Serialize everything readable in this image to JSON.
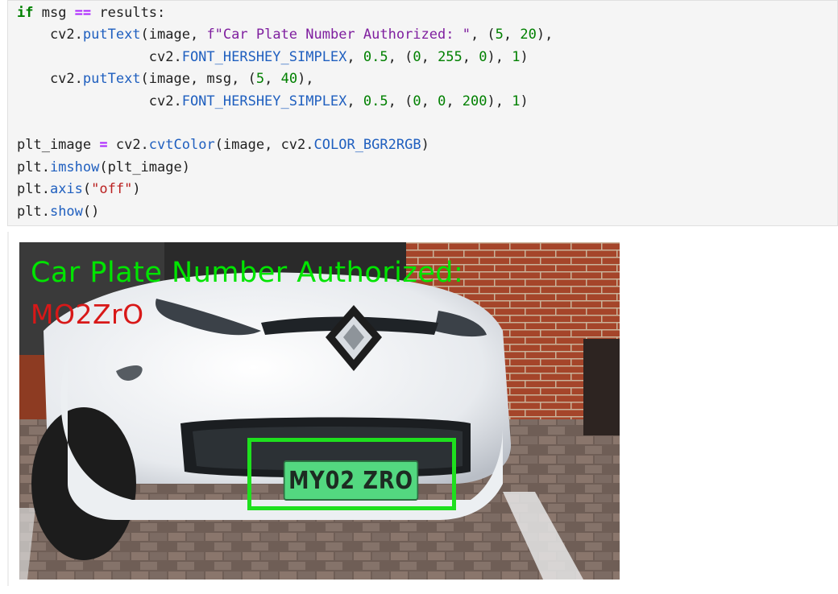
{
  "code_cell": {
    "lines": [
      "if msg == results:",
      "    cv2.putText(image, f\"Car Plate Number Authorized: \", (5, 20),",
      "                cv2.FONT_HERSHEY_SIMPLEX, 0.5, (0, 255, 0), 1)",
      "    cv2.putText(image, msg, (5, 40),",
      "                cv2.FONT_HERSHEY_SIMPLEX, 0.5, (0, 0, 200), 1)",
      "",
      "plt_image = cv2.cvtColor(image, cv2.COLOR_BGR2RGB)",
      "plt.imshow(plt_image)",
      "plt.axis(\"off\")",
      "plt.show()"
    ]
  },
  "output": {
    "overlay_text_line1": "Car Plate Number Authorized:",
    "overlay_text_line2": "MO2ZrO",
    "plate_text": "MY02 ZRO",
    "colors": {
      "overlay_line1": "#00e400",
      "overlay_line2": "#d81818",
      "detection_box": "#1ee01e",
      "plate_background": "#53d880"
    }
  }
}
